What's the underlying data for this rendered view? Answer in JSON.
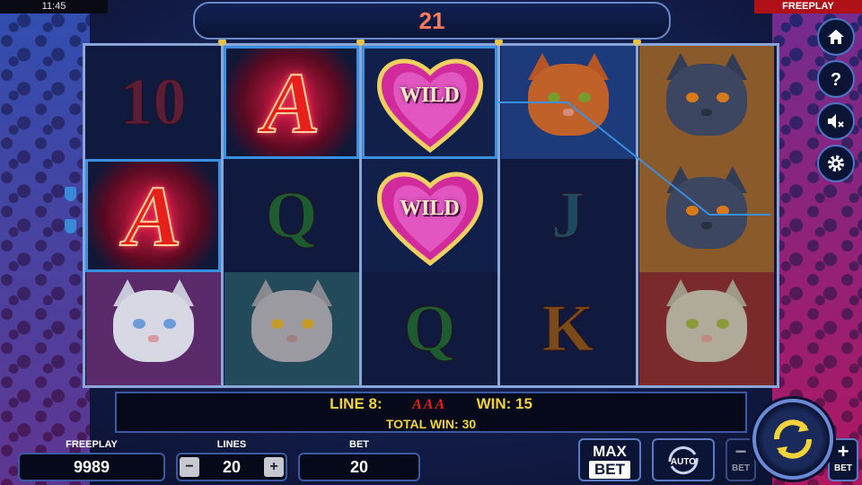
{
  "status_bar": {
    "time": "11:45",
    "mode": "FREEPLAY"
  },
  "free_spins": {
    "count": "21"
  },
  "reels": [
    [
      {
        "symbol": "10",
        "label": "10"
      },
      {
        "symbol": "A",
        "label": "A"
      },
      {
        "symbol": "cat-white",
        "label": ""
      }
    ],
    [
      {
        "symbol": "A",
        "label": "A"
      },
      {
        "symbol": "Q",
        "label": "Q"
      },
      {
        "symbol": "cat-silver",
        "label": ""
      }
    ],
    [
      {
        "symbol": "WILD",
        "label": "WILD"
      },
      {
        "symbol": "WILD",
        "label": "WILD"
      },
      {
        "symbol": "Q",
        "label": "Q"
      }
    ],
    [
      {
        "symbol": "cat-ginger",
        "label": ""
      },
      {
        "symbol": "J",
        "label": "J"
      },
      {
        "symbol": "K",
        "label": "K"
      }
    ],
    [
      {
        "symbol": "cat-grey",
        "label": ""
      },
      {
        "symbol": "cat-grey",
        "label": ""
      },
      {
        "symbol": "cat-tabby",
        "label": ""
      }
    ]
  ],
  "win_message": {
    "line_label": "LINE 8:",
    "line_symbols": "AAA",
    "win_label": "WIN: 15",
    "total_label": "TOTAL WIN: 30"
  },
  "controls": {
    "balance_label": "FREEPLAY",
    "balance_value": "9989",
    "lines_label": "LINES",
    "lines_value": "20",
    "lines_minus": "−",
    "lines_plus": "+",
    "bet_label": "BET",
    "bet_value": "20",
    "max_bet_top": "MAX",
    "max_bet_bottom": "BET",
    "auto_label": "AUTO",
    "bet_minus_sym": "−",
    "bet_minus_label": "BET",
    "bet_plus_sym": "+",
    "bet_plus_label": "BET"
  },
  "side_icons": [
    "home-icon",
    "help-icon",
    "sound-muted-icon",
    "settings-icon"
  ],
  "colors": {
    "win_text": "#f2d33c",
    "highlight": "#3a8fe0",
    "spins_count": "#ff7a5a",
    "freeplay_badge": "#b01018"
  }
}
